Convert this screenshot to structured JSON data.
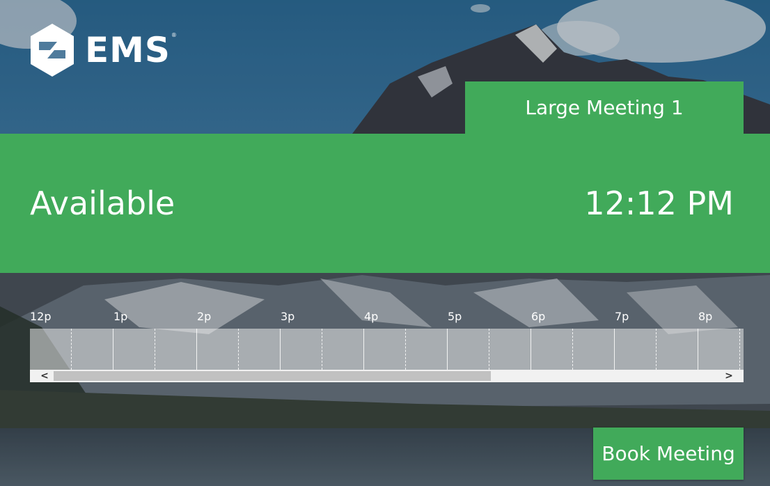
{
  "brand": {
    "name": "EMS",
    "trademark": "®"
  },
  "room": {
    "name": "Large Meeting 1"
  },
  "status": {
    "label": "Available",
    "time": "12:12 PM",
    "color": "#41aa5a"
  },
  "timeline": {
    "hours": [
      "12p",
      "1p",
      "2p",
      "3p",
      "4p",
      "5p",
      "6p",
      "7p",
      "8p"
    ],
    "scroll_left_icon": "<",
    "scroll_right_icon": ">"
  },
  "actions": {
    "book_label": "Book Meeting"
  },
  "icons": {
    "logo": "ems-logo-icon",
    "background": "mountain-lake-background",
    "scroll_left": "chevron-left-icon",
    "scroll_right": "chevron-right-icon"
  }
}
